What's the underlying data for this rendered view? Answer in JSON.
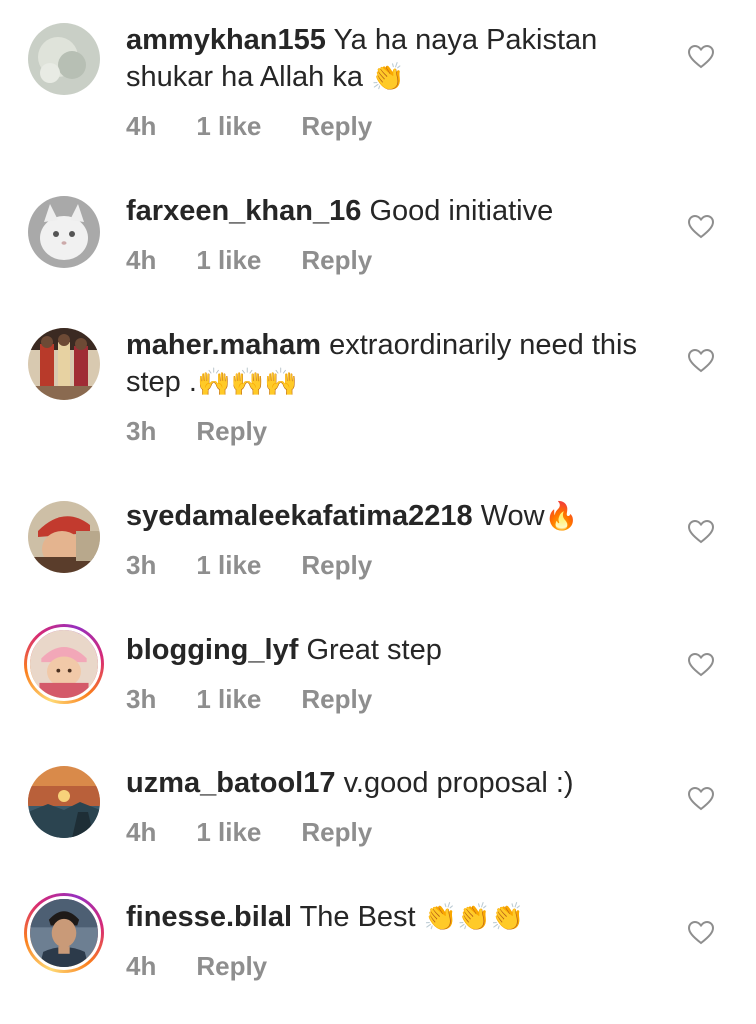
{
  "comments": [
    {
      "username": "ammykhan155",
      "text": "Ya ha naya Pakistan shukar ha Allah ka",
      "emoji": "👏",
      "time": "4h",
      "likes": "1 like",
      "reply": "Reply",
      "avatar": "grey-blur-avatar"
    },
    {
      "username": "farxeen_khan_16",
      "text": "Good initiative",
      "emoji": "",
      "time": "4h",
      "likes": "1 like",
      "reply": "Reply",
      "avatar": "white-cat-avatar"
    },
    {
      "username": "maher.maham",
      "text": "extraordinarily need this step .",
      "emoji": "🙌🙌🙌",
      "time": "3h",
      "likes": "",
      "reply": "Reply",
      "avatar": "wedding-avatar"
    },
    {
      "username": "syedamaleekafatima2218",
      "text": "Wow",
      "emoji": "🔥",
      "time": "3h",
      "likes": "1 like",
      "reply": "Reply",
      "avatar": "red-cap-avatar"
    },
    {
      "username": "blogging_lyf",
      "text": "Great step",
      "emoji": "",
      "time": "3h",
      "likes": "1 like",
      "reply": "Reply",
      "avatar": "child-pink-hat-avatar"
    },
    {
      "username": "uzma_batool17",
      "text": "v.good proposal :)",
      "emoji": "",
      "time": "4h",
      "likes": "1 like",
      "reply": "Reply",
      "avatar": "sunset-avatar"
    },
    {
      "username": "finesse.bilal",
      "text": "The Best",
      "emoji": "👏👏👏",
      "time": "4h",
      "likes": "",
      "reply": "Reply",
      "avatar": "man-portrait-avatar"
    }
  ],
  "colors": {
    "text": "#262626",
    "meta": "#8e8e8e",
    "heart_stroke": "#8e8e8e"
  }
}
